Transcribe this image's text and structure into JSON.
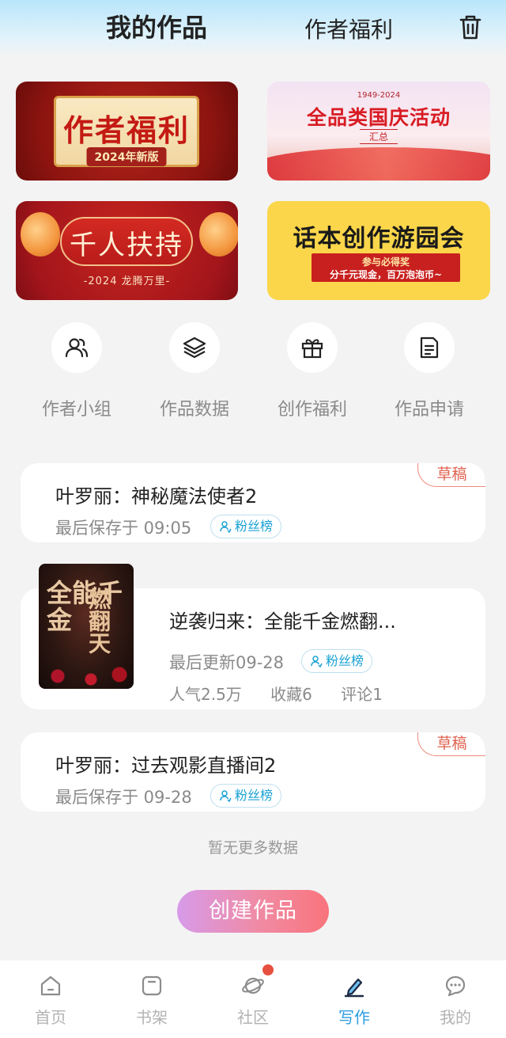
{
  "header": {
    "title": "我的作品",
    "welfare": "作者福利"
  },
  "banners": {
    "author_welfare": {
      "title": "作者福利",
      "year": "2024年新版"
    },
    "national_day": {
      "top": "1949-2024",
      "title": "全品类国庆活动",
      "sub": "汇总"
    },
    "support": {
      "title": "千人扶持",
      "sub": "-2024 龙腾万里-"
    },
    "garden": {
      "title": "话本创作游园会",
      "line1": "参与必得奖",
      "line2": "分千元现金，百万泡泡币~"
    }
  },
  "shortcuts": [
    {
      "label": "作者小组",
      "icon": "users-icon"
    },
    {
      "label": "作品数据",
      "icon": "layers-icon"
    },
    {
      "label": "创作福利",
      "icon": "gift-icon"
    },
    {
      "label": "作品申请",
      "icon": "document-icon"
    }
  ],
  "works": [
    {
      "title": "叶罗丽：神秘魔法使者2",
      "meta": "最后保存于 09:05",
      "tag": "草稿",
      "fans": "粉丝榜"
    },
    {
      "title": "逆袭归来：全能千金燃翻...",
      "meta": "最后更新09-28",
      "fans": "粉丝榜",
      "stats": [
        "人气2.5万",
        "收藏6",
        "评论1"
      ],
      "cover": {
        "text1": "全能千金",
        "text2": "燃翻天"
      }
    },
    {
      "title": "叶罗丽：过去观影直播间2",
      "meta": "最后保存于 09-28",
      "tag": "草稿",
      "fans": "粉丝榜"
    }
  ],
  "no_more": "暂无更多数据",
  "create_button": "创建作品",
  "tabbar": [
    {
      "label": "首页",
      "icon": "home-icon"
    },
    {
      "label": "书架",
      "icon": "bookshelf-icon"
    },
    {
      "label": "社区",
      "icon": "planet-icon"
    },
    {
      "label": "写作",
      "icon": "pen-icon",
      "active": true
    },
    {
      "label": "我的",
      "icon": "chat-icon"
    }
  ],
  "colors": {
    "accent": "#2b9de0",
    "draft": "#e0624f",
    "fans": "#1aa2d3"
  }
}
